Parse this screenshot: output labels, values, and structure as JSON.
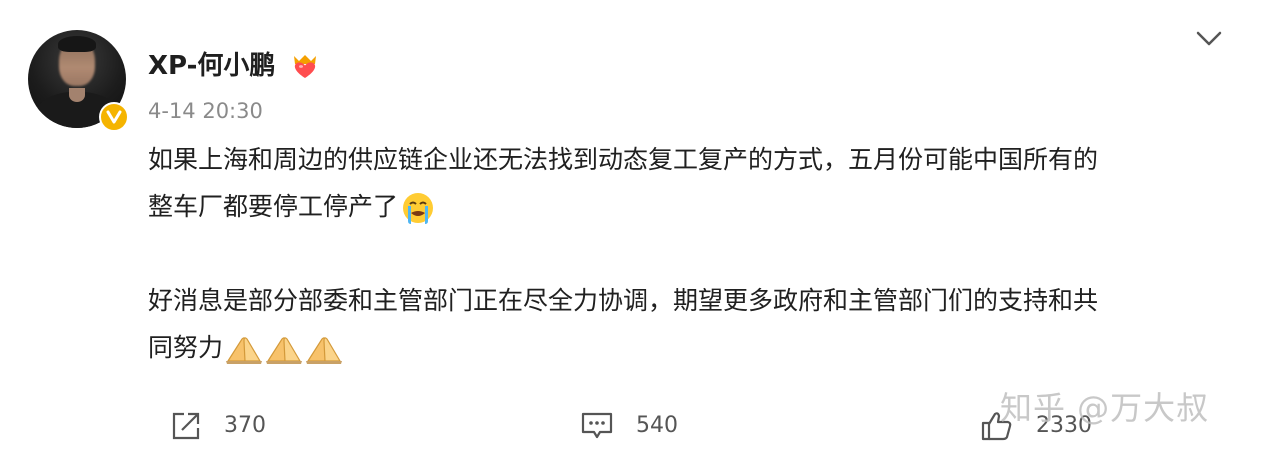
{
  "post": {
    "author": "XP-何小鹏",
    "timestamp": "4-14 20:30",
    "paragraph1_line1": "如果上海和周边的供应链企业还无法找到动态复工复产的方式，五月份可能中国所有的",
    "paragraph1_line2": "整车厂都要停工停产了",
    "paragraph2_line1": "好消息是部分部委和主管部门正在尽全力协调，期望更多政府和主管部门们的支持和共",
    "paragraph2_line2": "同努力"
  },
  "actions": {
    "repost_count": "370",
    "comment_count": "540",
    "like_count": "2330"
  },
  "watermark": "知乎 @万大叔",
  "icons": {
    "verify": "verified-badge-icon",
    "vip": "vip-heart-icon",
    "crying": "crying-emoji-icon",
    "pray": "praying-hands-emoji-icon",
    "repost": "share-arrow-icon",
    "comment": "comment-bubble-icon",
    "like": "thumbs-up-icon",
    "more": "chevron-down-icon"
  },
  "colors": {
    "verify_badge": "#f5b400",
    "text": "#202020",
    "meta": "#8a8a8a"
  }
}
